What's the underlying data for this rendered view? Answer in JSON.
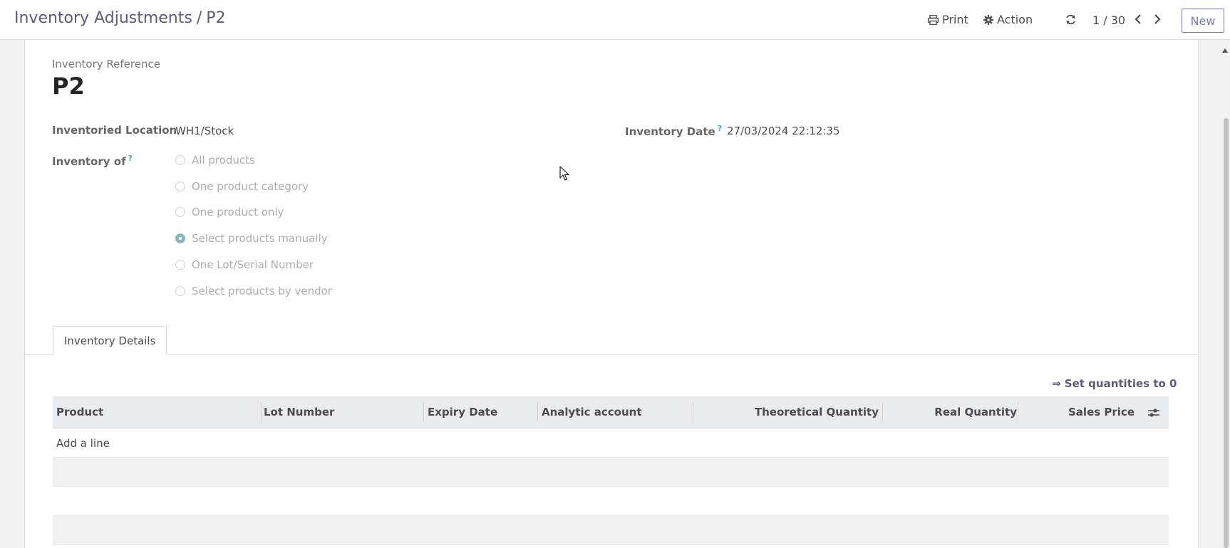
{
  "breadcrumb": {
    "parent": "Inventory Adjustments",
    "separator": "/",
    "current": "P2"
  },
  "toolbar": {
    "print_label": "Print",
    "action_label": "Action",
    "new_label": "New"
  },
  "pager": {
    "value": "1 / 30"
  },
  "form": {
    "reference_label": "Inventory Reference",
    "reference_value": "P2",
    "location_label": "Inventoried Location",
    "location_value": "WH1/Stock",
    "date_label": "Inventory Date",
    "date_help": "?",
    "date_value": "27/03/2024 22:12:35",
    "inventory_of_label": "Inventory of",
    "inventory_of_help": "?",
    "inventory_of_options": [
      {
        "label": "All products",
        "checked": false
      },
      {
        "label": "One product category",
        "checked": false
      },
      {
        "label": "One product only",
        "checked": false
      },
      {
        "label": "Select products manually",
        "checked": true
      },
      {
        "label": "One Lot/Serial Number",
        "checked": false
      },
      {
        "label": "Select products by vendor",
        "checked": false
      }
    ]
  },
  "tabs": [
    {
      "label": "Inventory Details",
      "active": true
    }
  ],
  "lines": {
    "set_quantities_label": "⇒ Set quantities to 0",
    "columns": [
      "Product",
      "Lot Number",
      "Expiry Date",
      "Analytic account",
      "Theoretical Quantity",
      "Real Quantity",
      "Sales Price"
    ],
    "add_line_label": "Add a line",
    "rows": []
  },
  "icons": {
    "print": "print-icon",
    "action": "gear-icon",
    "refresh": "refresh-icon",
    "prev": "chevron-left-icon",
    "next": "chevron-right-icon",
    "optional_columns": "sliders-icon"
  },
  "colors": {
    "accent": "#7c7bad",
    "help": "#45a3b8",
    "header_bg": "#e9ecef"
  }
}
